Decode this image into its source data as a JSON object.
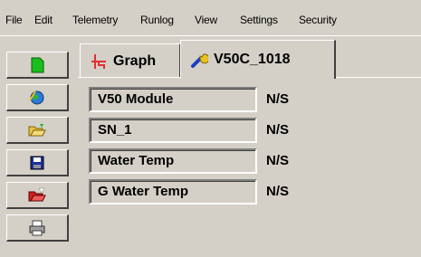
{
  "menu": [
    "File",
    "Edit",
    "Telemetry",
    "Runlog",
    "View",
    "Settings",
    "Security"
  ],
  "toolbar": {
    "buttons": [
      {
        "icon": "new-document-icon",
        "color": "#1bbf1b"
      },
      {
        "icon": "globe-icon",
        "color": "#2a7bd6"
      },
      {
        "icon": "open-folder-icon",
        "color": "#e8c43a"
      },
      {
        "icon": "save-disk-icon",
        "color": "#1a2f9c"
      },
      {
        "icon": "open-red-folder-icon",
        "color": "#d02020"
      },
      {
        "icon": "printer-icon",
        "color": "#606060"
      }
    ]
  },
  "tabs": [
    {
      "label": "Graph",
      "icon": "graph-icon",
      "icon_color": "#e03030"
    },
    {
      "label": "V50C_1018",
      "icon": "wrench-icon",
      "icon_color": "#1a3fc0"
    }
  ],
  "fields": [
    {
      "label": "V50 Module",
      "value": "N/S"
    },
    {
      "label": "SN_1",
      "value": "N/S"
    },
    {
      "label": "Water Temp",
      "value": "N/S"
    },
    {
      "label": "G Water Temp",
      "value": "N/S"
    }
  ]
}
